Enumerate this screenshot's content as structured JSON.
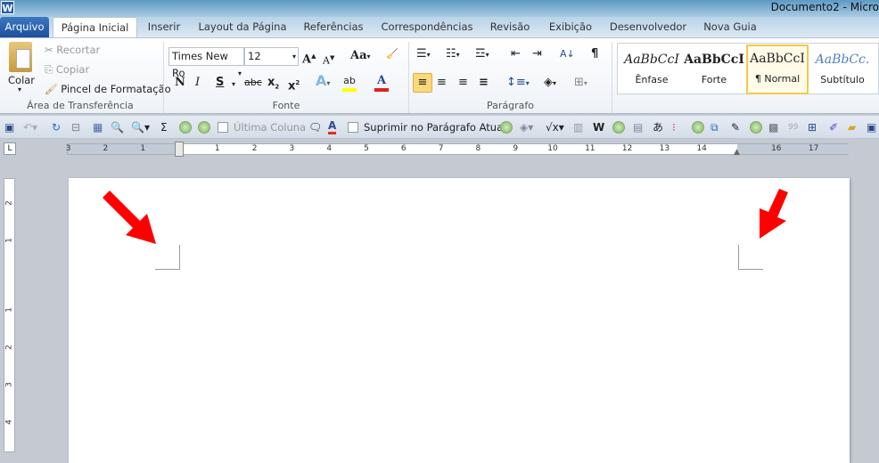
{
  "window": {
    "title": "Documento2 - Micro",
    "app_icon": "W"
  },
  "tabs": [
    "Arquivo",
    "Página Inicial",
    "Inserir",
    "Layout da Página",
    "Referências",
    "Correspondências",
    "Revisão",
    "Exibição",
    "Desenvolvedor",
    "Nova Guia"
  ],
  "clipboard": {
    "paste": "Colar",
    "cut": "Recortar",
    "copy": "Copiar",
    "format_painter": "Pincel de Formatação",
    "label": "Área de Transferência"
  },
  "font": {
    "name": "Times New Ro",
    "size": "12",
    "label": "Fonte",
    "bold": "N",
    "italic": "I",
    "underline": "S",
    "strike": "abc",
    "case": "Aa",
    "highlight_color": "#ffff00",
    "font_color": "#e02020"
  },
  "paragraph": {
    "label": "Parágrafo",
    "pilcrow": "¶"
  },
  "styles": [
    {
      "preview": "AaBbCcI",
      "name": "Ênfase"
    },
    {
      "preview": "AaBbCcI",
      "name": "Forte"
    },
    {
      "preview": "AaBbCcI",
      "name": "¶ Normal",
      "selected": true
    },
    {
      "preview": "AaBbCc.",
      "name": "Subtítulo"
    }
  ],
  "qat": {
    "sigma": "Σ",
    "last_column": "Última Coluna",
    "suppress": "Suprimir no Parágrafo Atual"
  },
  "ruler": {
    "left": [
      "3",
      "2",
      "1"
    ],
    "right": [
      "1",
      "2",
      "3",
      "4",
      "5",
      "6",
      "7",
      "8",
      "9",
      "10",
      "11",
      "12",
      "13",
      "14",
      "16",
      "17"
    ],
    "vertical": [
      "2",
      "1",
      "1",
      "2",
      "3",
      "4"
    ]
  },
  "annotation_color": "#ff0000"
}
